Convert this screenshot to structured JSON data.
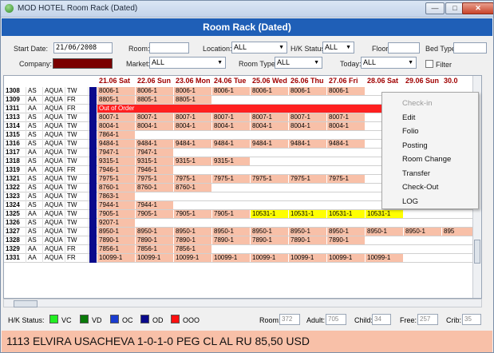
{
  "window": {
    "title": "MOD HOTEL Room Rack (Dated)",
    "header": "Room Rack (Dated)"
  },
  "filters": {
    "start_date_label": "Start Date:",
    "start_date": "21/06/2008",
    "room_label": "Room:",
    "room_value": "",
    "location_label": "Location:",
    "location_value": "ALL",
    "hk_status_label": "H/K Status:",
    "hk_status_value": "ALL",
    "floor_label": "Floor:",
    "floor_value": "",
    "bed_type_label": "Bed Type:",
    "bed_type_value": "",
    "company_label": "Company:",
    "market_label": "Market:",
    "market_value": "ALL",
    "room_type_label": "Room Type:",
    "room_type_value": "ALL",
    "today_label": "Today:",
    "today_value": "ALL",
    "filter_label": "Filter"
  },
  "days": [
    "21.06 Sat",
    "22.06 Sun",
    "23.06 Mon",
    "24.06 Tue",
    "25.06 Wed",
    "26.06 Thu",
    "27.06 Fri",
    "28.06 Sat",
    "29.06 Sun",
    "30.0"
  ],
  "rows": [
    {
      "room": "1308",
      "t1": "AS",
      "t2": "AQUA",
      "t3": "TW",
      "bookings": [
        {
          "start": 0,
          "text": "8006-1",
          "color": "salmon"
        },
        {
          "start": 1,
          "text": "8006-1",
          "color": "salmon"
        },
        {
          "start": 2,
          "text": "8006-1",
          "color": "salmon"
        },
        {
          "start": 3,
          "text": "8006-1",
          "color": "salmon"
        },
        {
          "start": 4,
          "text": "8006-1",
          "color": "salmon"
        },
        {
          "start": 5,
          "text": "8006-1",
          "color": "salmon"
        },
        {
          "start": 6,
          "text": "8006-1",
          "color": "salmon"
        }
      ]
    },
    {
      "room": "1309",
      "t1": "AA",
      "t2": "AQUA",
      "t3": "FR",
      "bookings": [
        {
          "start": 0,
          "text": "8805-1",
          "color": "salmon"
        },
        {
          "start": 1,
          "text": "8805-1",
          "color": "salmon"
        },
        {
          "start": 2,
          "text": "8805-1",
          "color": "salmon"
        }
      ]
    },
    {
      "room": "1311",
      "t1": "AA",
      "t2": "AQUA",
      "t3": "FR",
      "bookings": [
        {
          "start": 0,
          "span": 8,
          "text": "Out of Order",
          "color": "red"
        }
      ]
    },
    {
      "room": "1313",
      "t1": "AS",
      "t2": "AQUA",
      "t3": "TW",
      "bookings": [
        {
          "start": 0,
          "text": "8007-1",
          "color": "salmon"
        },
        {
          "start": 1,
          "text": "8007-1",
          "color": "salmon"
        },
        {
          "start": 2,
          "text": "8007-1",
          "color": "salmon"
        },
        {
          "start": 3,
          "text": "8007-1",
          "color": "salmon"
        },
        {
          "start": 4,
          "text": "8007-1",
          "color": "salmon"
        },
        {
          "start": 5,
          "text": "8007-1",
          "color": "salmon"
        },
        {
          "start": 6,
          "text": "8007-1",
          "color": "salmon"
        }
      ]
    },
    {
      "room": "1314",
      "t1": "AS",
      "t2": "AQUA",
      "t3": "TW",
      "bookings": [
        {
          "start": 0,
          "text": "8004-1",
          "color": "salmon"
        },
        {
          "start": 1,
          "text": "8004-1",
          "color": "salmon"
        },
        {
          "start": 2,
          "text": "8004-1",
          "color": "salmon"
        },
        {
          "start": 3,
          "text": "8004-1",
          "color": "salmon"
        },
        {
          "start": 4,
          "text": "8004-1",
          "color": "salmon"
        },
        {
          "start": 5,
          "text": "8004-1",
          "color": "salmon"
        },
        {
          "start": 6,
          "text": "8004-1",
          "color": "salmon"
        }
      ]
    },
    {
      "room": "1315",
      "t1": "AS",
      "t2": "AQUA",
      "t3": "TW",
      "bookings": [
        {
          "start": 0,
          "text": "7864-1",
          "color": "salmon"
        }
      ]
    },
    {
      "room": "1316",
      "t1": "AS",
      "t2": "AQUA",
      "t3": "TW",
      "bookings": [
        {
          "start": 0,
          "text": "9484-1",
          "color": "salmon"
        },
        {
          "start": 1,
          "text": "9484-1",
          "color": "salmon"
        },
        {
          "start": 2,
          "text": "9484-1",
          "color": "salmon"
        },
        {
          "start": 3,
          "text": "9484-1",
          "color": "salmon"
        },
        {
          "start": 4,
          "text": "9484-1",
          "color": "salmon"
        },
        {
          "start": 5,
          "text": "9484-1",
          "color": "salmon"
        },
        {
          "start": 6,
          "text": "9484-1",
          "color": "salmon"
        }
      ]
    },
    {
      "room": "1317",
      "t1": "AA",
      "t2": "AQUA",
      "t3": "TW",
      "bookings": [
        {
          "start": 0,
          "text": "7947-1",
          "color": "salmon"
        },
        {
          "start": 1,
          "text": "7947-1",
          "color": "salmon"
        }
      ]
    },
    {
      "room": "1318",
      "t1": "AS",
      "t2": "AQUA",
      "t3": "TW",
      "bookings": [
        {
          "start": 0,
          "text": "9315-1",
          "color": "salmon"
        },
        {
          "start": 1,
          "text": "9315-1",
          "color": "salmon"
        },
        {
          "start": 2,
          "text": "9315-1",
          "color": "salmon"
        },
        {
          "start": 3,
          "text": "9315-1",
          "color": "salmon"
        }
      ]
    },
    {
      "room": "1319",
      "t1": "AA",
      "t2": "AQUA",
      "t3": "FR",
      "bookings": [
        {
          "start": 0,
          "text": "7946-1",
          "color": "salmon"
        },
        {
          "start": 1,
          "text": "7946-1",
          "color": "salmon"
        }
      ]
    },
    {
      "room": "1321",
      "t1": "AS",
      "t2": "AQUA",
      "t3": "TW",
      "bookings": [
        {
          "start": 0,
          "text": "7975-1",
          "color": "salmon"
        },
        {
          "start": 1,
          "text": "7975-1",
          "color": "salmon"
        },
        {
          "start": 2,
          "text": "7975-1",
          "color": "salmon"
        },
        {
          "start": 3,
          "text": "7975-1",
          "color": "salmon"
        },
        {
          "start": 4,
          "text": "7975-1",
          "color": "salmon"
        },
        {
          "start": 5,
          "text": "7975-1",
          "color": "salmon"
        },
        {
          "start": 6,
          "text": "7975-1",
          "color": "salmon"
        }
      ]
    },
    {
      "room": "1322",
      "t1": "AS",
      "t2": "AQUA",
      "t3": "TW",
      "bookings": [
        {
          "start": 0,
          "text": "8760-1",
          "color": "salmon"
        },
        {
          "start": 1,
          "text": "8760-1",
          "color": "salmon"
        },
        {
          "start": 2,
          "text": "8760-1",
          "color": "salmon"
        }
      ]
    },
    {
      "room": "1323",
      "t1": "AS",
      "t2": "AQUA",
      "t3": "TW",
      "bookings": [
        {
          "start": 0,
          "text": "7863-1",
          "color": "salmon"
        }
      ]
    },
    {
      "room": "1324",
      "t1": "AS",
      "t2": "AQUA",
      "t3": "TW",
      "bookings": [
        {
          "start": 0,
          "text": "7944-1",
          "color": "salmon"
        },
        {
          "start": 1,
          "text": "7944-1",
          "color": "salmon"
        }
      ]
    },
    {
      "room": "1325",
      "t1": "AA",
      "t2": "AQUA",
      "t3": "TW",
      "bookings": [
        {
          "start": 0,
          "text": "7905-1",
          "color": "salmon"
        },
        {
          "start": 1,
          "text": "7905-1",
          "color": "salmon"
        },
        {
          "start": 2,
          "text": "7905-1",
          "color": "salmon"
        },
        {
          "start": 3,
          "text": "7905-1",
          "color": "salmon"
        },
        {
          "start": 4,
          "text": "10531-1",
          "color": "yellow"
        },
        {
          "start": 5,
          "text": "10531-1",
          "color": "yellow"
        },
        {
          "start": 6,
          "text": "10531-1",
          "color": "yellow"
        },
        {
          "start": 7,
          "text": "10531-1",
          "color": "yellow"
        }
      ]
    },
    {
      "room": "1326",
      "t1": "AS",
      "t2": "AQUA",
      "t3": "TW",
      "bookings": [
        {
          "start": 0,
          "text": "9207-1",
          "color": "salmon"
        }
      ]
    },
    {
      "room": "1327",
      "t1": "AS",
      "t2": "AQUA",
      "t3": "TW",
      "bookings": [
        {
          "start": 0,
          "text": "8950-1",
          "color": "salmon"
        },
        {
          "start": 1,
          "text": "8950-1",
          "color": "salmon"
        },
        {
          "start": 2,
          "text": "8950-1",
          "color": "salmon"
        },
        {
          "start": 3,
          "text": "8950-1",
          "color": "salmon"
        },
        {
          "start": 4,
          "text": "8950-1",
          "color": "salmon"
        },
        {
          "start": 5,
          "text": "8950-1",
          "color": "salmon"
        },
        {
          "start": 6,
          "text": "8950-1",
          "color": "salmon"
        },
        {
          "start": 7,
          "text": "8950-1",
          "color": "salmon"
        },
        {
          "start": 8,
          "text": "8950-1",
          "color": "salmon"
        },
        {
          "start": 9,
          "text": "895",
          "color": "salmon"
        }
      ]
    },
    {
      "room": "1328",
      "t1": "AS",
      "t2": "AQUA",
      "t3": "TW",
      "bookings": [
        {
          "start": 0,
          "text": "7890-1",
          "color": "salmon"
        },
        {
          "start": 1,
          "text": "7890-1",
          "color": "salmon"
        },
        {
          "start": 2,
          "text": "7890-1",
          "color": "salmon"
        },
        {
          "start": 3,
          "text": "7890-1",
          "color": "salmon"
        },
        {
          "start": 4,
          "text": "7890-1",
          "color": "salmon"
        },
        {
          "start": 5,
          "text": "7890-1",
          "color": "salmon"
        },
        {
          "start": 6,
          "text": "7890-1",
          "color": "salmon"
        }
      ]
    },
    {
      "room": "1329",
      "t1": "AA",
      "t2": "AQUA",
      "t3": "FR",
      "bookings": [
        {
          "start": 0,
          "text": "7856-1",
          "color": "salmon"
        },
        {
          "start": 1,
          "text": "7856-1",
          "color": "salmon"
        },
        {
          "start": 2,
          "text": "7856-1",
          "color": "salmon"
        }
      ]
    },
    {
      "room": "1331",
      "t1": "AA",
      "t2": "AQUA",
      "t3": "FR",
      "bookings": [
        {
          "start": 0,
          "text": "10099-1",
          "color": "salmon"
        },
        {
          "start": 1,
          "text": "10099-1",
          "color": "salmon"
        },
        {
          "start": 2,
          "text": "10099-1",
          "color": "salmon"
        },
        {
          "start": 3,
          "text": "10099-1",
          "color": "salmon"
        },
        {
          "start": 4,
          "text": "10099-1",
          "color": "salmon"
        },
        {
          "start": 5,
          "text": "10099-1",
          "color": "salmon"
        },
        {
          "start": 6,
          "text": "10099-1",
          "color": "salmon"
        },
        {
          "start": 7,
          "text": "10099-1",
          "color": "salmon"
        }
      ]
    }
  ],
  "context_menu": [
    {
      "label": "Check-in",
      "disabled": true
    },
    {
      "label": "Edit",
      "disabled": false
    },
    {
      "label": "Folio",
      "disabled": false
    },
    {
      "label": "Posting",
      "disabled": false
    },
    {
      "label": "Room Change",
      "disabled": false
    },
    {
      "label": "Transfer",
      "disabled": false
    },
    {
      "label": "Check-Out",
      "disabled": false
    },
    {
      "label": "LOG",
      "disabled": false
    }
  ],
  "status": {
    "hk_label": "H/K Status:",
    "legend": [
      {
        "label": "VC",
        "color": "#22ee22"
      },
      {
        "label": "VD",
        "color": "#0a7a0a"
      },
      {
        "label": "OC",
        "color": "#1a3cd0"
      },
      {
        "label": "OD",
        "color": "#0a0a8c"
      },
      {
        "label": "OOO",
        "color": "#ff1010"
      }
    ],
    "room_label": "Room:",
    "room_value": "372",
    "adult_label": "Adult:",
    "adult_value": "705",
    "child_label": "Child:",
    "child_value": "34",
    "free_label": "Free:",
    "free_value": "257",
    "crib_label": "Crib:",
    "crib_value": "35"
  },
  "info_bar": "1113  ELVIRA USACHEVA 1-0-1-0  PEG  CL AL RU  85,50 USD",
  "colors": {
    "header": "#1f5fb7",
    "salmon": "#f8c0a8",
    "yellow": "#ffff00",
    "red": "#ff2020",
    "company": "#7a0000"
  }
}
